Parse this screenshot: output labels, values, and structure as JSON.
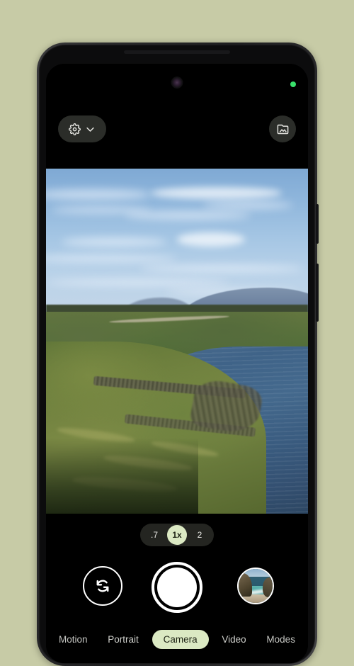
{
  "app": {
    "name": "Camera",
    "theme_accent": "#dbe9c3",
    "background_color": "#c7cba6",
    "ui_background": "#000000"
  },
  "status": {
    "privacy_indicator": "camera-in-use-dot",
    "privacy_indicator_color": "#39e06b"
  },
  "top_bar": {
    "settings": {
      "gear_icon": "gear-icon",
      "chevron_icon": "chevron-down-icon",
      "label": "Settings"
    },
    "gallery": {
      "icon": "photo-library-icon",
      "label": "Gallery"
    }
  },
  "viewfinder": {
    "description": "Landscape photo: cream house with dark green roof beside a blue lake, green grassy hills, distant mountain under a partly cloudy blue sky",
    "alt": "Live camera preview"
  },
  "zoom": {
    "options": [
      {
        "label": ".7",
        "value": "0.7",
        "selected": false
      },
      {
        "label": "1x",
        "value": "1",
        "selected": true
      },
      {
        "label": "2",
        "value": "2",
        "selected": false
      }
    ],
    "selected_label": "1x"
  },
  "controls": {
    "flip_camera": {
      "icon": "camera-flip-icon",
      "label": "Switch camera"
    },
    "shutter": {
      "label": "Take photo",
      "icon": "shutter-icon"
    },
    "thumbnail": {
      "label": "Last photo",
      "description": "Coastal cliffs with turquoise water and sandy beach"
    }
  },
  "modes": [
    {
      "label": "Motion",
      "active": false
    },
    {
      "label": "Portrait",
      "active": false
    },
    {
      "label": "Camera",
      "active": true
    },
    {
      "label": "Video",
      "active": false
    },
    {
      "label": "Modes",
      "active": false
    }
  ]
}
